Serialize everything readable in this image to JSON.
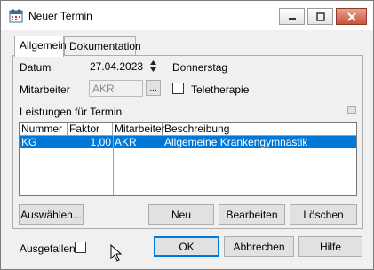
{
  "window": {
    "title": "Neuer Termin",
    "accent": "#0078d7"
  },
  "tabs": [
    {
      "label": "Allgemein",
      "active": true
    },
    {
      "label": "Dokumentation",
      "active": false
    }
  ],
  "form": {
    "datum_label": "Datum",
    "datum_value": "27.04.2023",
    "weekday": "Donnerstag",
    "mitarbeiter_label": "Mitarbeiter",
    "mitarbeiter_value": "AKR",
    "browse_label": "...",
    "teletherapie_label": "Teletherapie",
    "teletherapie_checked": false
  },
  "leistungen": {
    "label": "Leistungen für Termin",
    "columns": [
      "Nummer",
      "Faktor",
      "Mitarbeiter",
      "Beschreibung"
    ],
    "rows": [
      {
        "nummer": "KG",
        "faktor": "1,00",
        "mitarbeiter": "AKR",
        "beschreibung": "Allgemeine Krankengymnastik",
        "selected": true
      }
    ]
  },
  "panel_buttons": {
    "auswaehlen": "Auswählen...",
    "neu": "Neu",
    "bearbeiten": "Bearbeiten",
    "loeschen": "Löschen"
  },
  "footer": {
    "ausgefallen_label": "Ausgefallen",
    "ausgefallen_checked": false,
    "ok": "OK",
    "abbrechen": "Abbrechen",
    "hilfe": "Hilfe"
  }
}
